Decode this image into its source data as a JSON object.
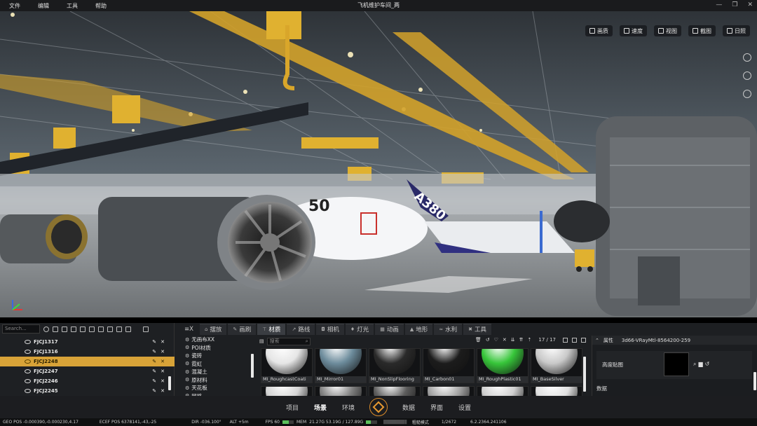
{
  "menu": [
    "文件",
    "编辑",
    "工具",
    "帮助"
  ],
  "window_title": "飞机维护车间_两",
  "viewport_toolbar": [
    {
      "label": "画质",
      "icon": "image-icon"
    },
    {
      "label": "速度",
      "icon": "speed-icon"
    },
    {
      "label": "视图",
      "icon": "view-icon"
    },
    {
      "label": "截图",
      "icon": "screenshot-icon"
    },
    {
      "label": "日照",
      "icon": "sun-icon"
    }
  ],
  "scene_text": {
    "engine_nose": "50",
    "tail": "A380"
  },
  "left_panel": {
    "search_placeholder": "Search...",
    "items": [
      {
        "label": "FJCJ1317",
        "selected": false
      },
      {
        "label": "FJCJ1316",
        "selected": false
      },
      {
        "label": "FJCJ2248",
        "selected": true
      },
      {
        "label": "FJCJ2247",
        "selected": false
      },
      {
        "label": "FJCJ2246",
        "selected": false
      },
      {
        "label": "FJCJ2245",
        "selected": false
      }
    ]
  },
  "tabs": [
    {
      "label": "摆放",
      "active": false
    },
    {
      "label": "画刷",
      "active": false
    },
    {
      "label": "材质",
      "active": true
    },
    {
      "label": "路线",
      "active": false
    },
    {
      "label": "相机",
      "active": false
    },
    {
      "label": "灯光",
      "active": false
    },
    {
      "label": "动画",
      "active": false
    },
    {
      "label": "地形",
      "active": false
    },
    {
      "label": "水利",
      "active": false
    },
    {
      "label": "工具",
      "active": false
    }
  ],
  "tab_prefix": "≡X",
  "material_tree": [
    "无画布XX",
    "POI材质",
    "瓷砖",
    "霓虹",
    "混凝土",
    "原材料",
    "天花板",
    "网格"
  ],
  "material_search_placeholder": "搜索",
  "page_counter": "17 / 17",
  "materials": [
    {
      "label": "MI_RoughcastCoati",
      "color": "#e6e6e6"
    },
    {
      "label": "MI_Mirror01",
      "color": "#6d8c9c"
    },
    {
      "label": "MI_NonSlipFlooring",
      "color": "#2a2a2a"
    },
    {
      "label": "MI_Carbon01",
      "color": "#1c1c1c"
    },
    {
      "label": "MI_RoughPlastic01",
      "color": "#37c63a"
    },
    {
      "label": "MI_BaseSilver",
      "color": "#c9c9c9"
    },
    {
      "label": "",
      "color": "#d4d4d4"
    },
    {
      "label": "",
      "color": "#7f7f7f"
    },
    {
      "label": "",
      "color": "#5c5c5c"
    },
    {
      "label": "",
      "color": "#a0a0a0"
    },
    {
      "label": "",
      "color": "#cfcfcf"
    },
    {
      "label": "",
      "color": "#e0e0e0"
    }
  ],
  "properties": {
    "header": "属性",
    "object_id": "3d66-VRayMtl-8564200-259",
    "height_map_label": "高度贴图",
    "data_label": "数据"
  },
  "nav": [
    {
      "label": "项目",
      "active": false
    },
    {
      "label": "场景",
      "active": true
    },
    {
      "label": "环境",
      "active": false
    },
    {
      "label": "数据",
      "active": false
    },
    {
      "label": "界面",
      "active": false
    },
    {
      "label": "设置",
      "active": false
    }
  ],
  "status": {
    "geo_pos": "GEO POS  -0.000390,-0.000230,4.17",
    "ecef_pos": "ECEF POS  6378141,-43,-25",
    "dir": "DIR  -036.100°",
    "alt": "ALT  +5m",
    "fps": "FPS  60",
    "mem": "MEM",
    "mem_val": "21.27G  53.19G / 127.89G",
    "mode": "粗糙模式",
    "count": "1/2672",
    "version": "6.2.2364.241106",
    "fps_fraction": 0.55,
    "mem_fraction": 0.42
  }
}
